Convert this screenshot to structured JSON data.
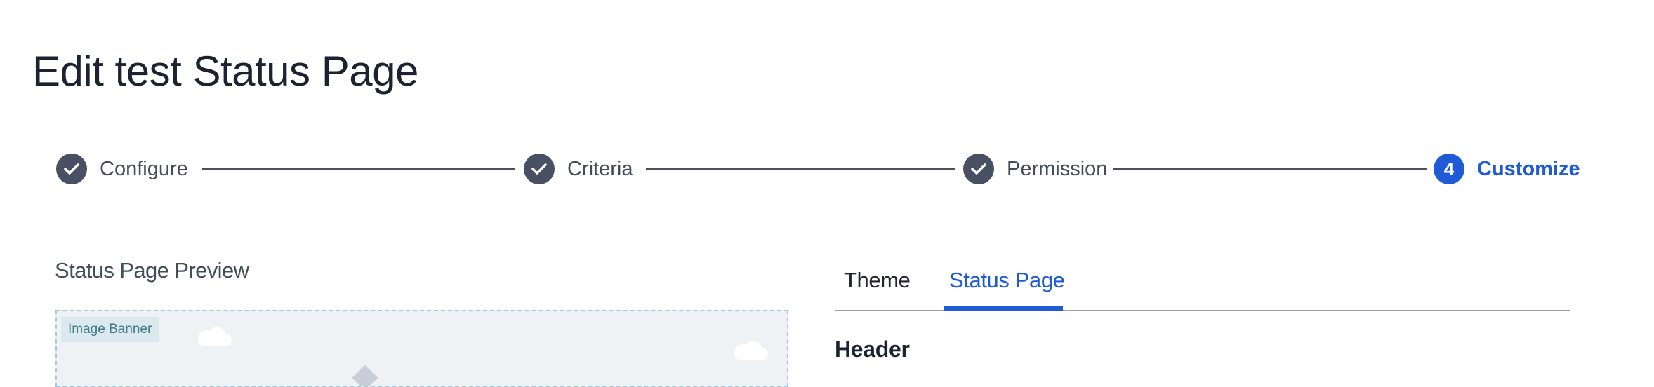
{
  "page": {
    "title": "Edit test Status Page"
  },
  "stepper": {
    "steps": [
      {
        "label": "Configure",
        "state": "complete"
      },
      {
        "label": "Criteria",
        "state": "complete"
      },
      {
        "label": "Permission",
        "state": "complete"
      },
      {
        "label": "Customize",
        "state": "active",
        "number": "4"
      }
    ]
  },
  "preview": {
    "title": "Status Page Preview",
    "banner_label": "Image Banner"
  },
  "tabs": [
    {
      "label": "Theme",
      "selected": false
    },
    {
      "label": "Status Page",
      "selected": true
    }
  ],
  "section": {
    "header": "Header"
  },
  "colors": {
    "accent": "#1f5bd6",
    "step_complete": "#4a5063"
  }
}
